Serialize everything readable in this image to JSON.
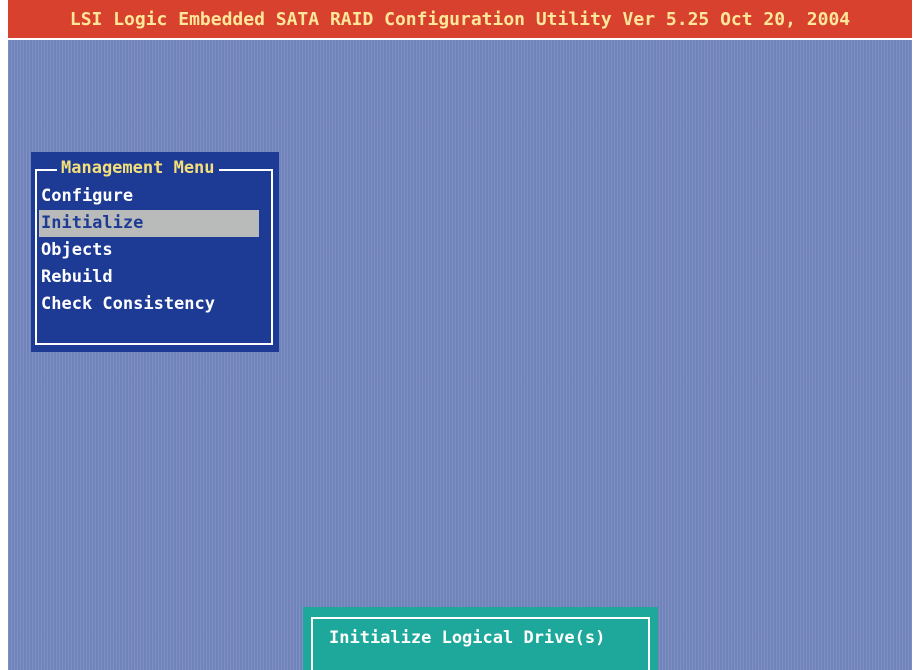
{
  "title_bar": {
    "text": "LSI Logic Embedded SATA RAID Configuration Utility Ver 5.25 Oct 20, 2004"
  },
  "management_menu": {
    "title": "Management Menu",
    "items": [
      {
        "label": "Configure",
        "selected": false
      },
      {
        "label": "Initialize",
        "selected": true
      },
      {
        "label": "Objects",
        "selected": false
      },
      {
        "label": "Rebuild",
        "selected": false
      },
      {
        "label": "Check Consistency",
        "selected": false
      }
    ]
  },
  "status_bar": {
    "text": "Initialize Logical Drive(s)"
  },
  "colors": {
    "background": "#7083ba",
    "title_bar": "#d8412e",
    "title_text": "#ffe79a",
    "menu_background": "#1d3a94",
    "menu_title": "#f3e07a",
    "selection_highlight": "#b9bbbb",
    "status_background": "#1ea89b"
  }
}
